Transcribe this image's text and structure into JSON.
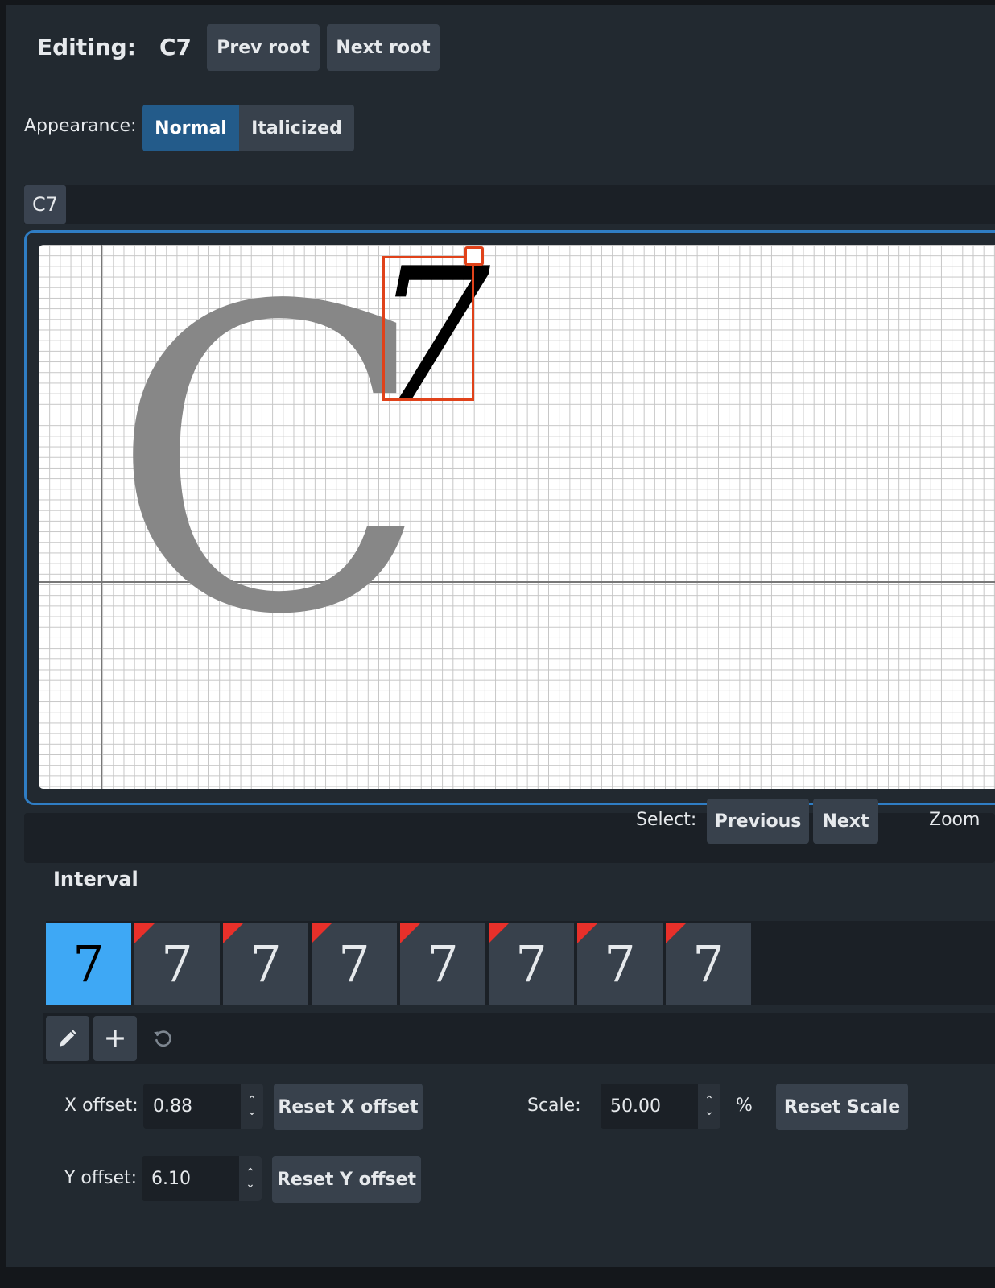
{
  "header": {
    "editing_label": "Editing:",
    "editing_value": "C7",
    "prev_root": "Prev root",
    "next_root": "Next root"
  },
  "appearance": {
    "label": "Appearance:",
    "options": [
      "Normal",
      "Italicized"
    ],
    "selected": "Normal"
  },
  "editor": {
    "tab_label": "C7",
    "root_glyph": "C",
    "superscript_glyph": "7"
  },
  "select_bar": {
    "label": "Select:",
    "previous": "Previous",
    "next": "Next",
    "zoom_label": "Zoom"
  },
  "interval": {
    "heading": "Interval",
    "cells": [
      "7",
      "7",
      "7",
      "7",
      "7",
      "7",
      "7",
      "7"
    ],
    "selected_index": 0,
    "edited_marker_color": "#e8302a"
  },
  "tools": {
    "edit_icon": "pencil-icon",
    "add_icon": "plus-icon",
    "reset_icon": "rotate-ccw-icon"
  },
  "offsets": {
    "x_label": "X offset:",
    "x_value": "0.88",
    "reset_x": "Reset X offset",
    "y_label": "Y offset:",
    "y_value": "6.10",
    "reset_y": "Reset Y offset",
    "scale_label": "Scale:",
    "scale_value": "50.00",
    "scale_unit": "%",
    "reset_scale": "Reset Scale"
  },
  "colors": {
    "accent": "#2f7dc4",
    "selection": "#e0421a",
    "active_cell": "#3ea8f5"
  }
}
